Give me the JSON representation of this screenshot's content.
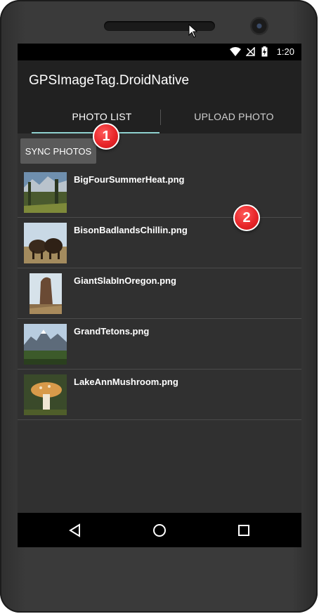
{
  "status_bar": {
    "time": "1:20"
  },
  "app": {
    "title": "GPSImageTag.DroidNative"
  },
  "tabs": [
    {
      "label": "PHOTO LIST",
      "selected": true
    },
    {
      "label": "UPLOAD PHOTO",
      "selected": false
    }
  ],
  "sync_button": {
    "label": "SYNC PHOTOS"
  },
  "photos": [
    {
      "name": "BigFourSummerHeat.png"
    },
    {
      "name": "BisonBadlandsChillin.png"
    },
    {
      "name": "GiantSlabInOregon.png"
    },
    {
      "name": "GrandTetons.png"
    },
    {
      "name": "LakeAnnMushroom.png"
    }
  ],
  "callouts": {
    "one": "1",
    "two": "2"
  },
  "colors": {
    "accent": "#8fd1cf",
    "callout": "#e8262a"
  }
}
